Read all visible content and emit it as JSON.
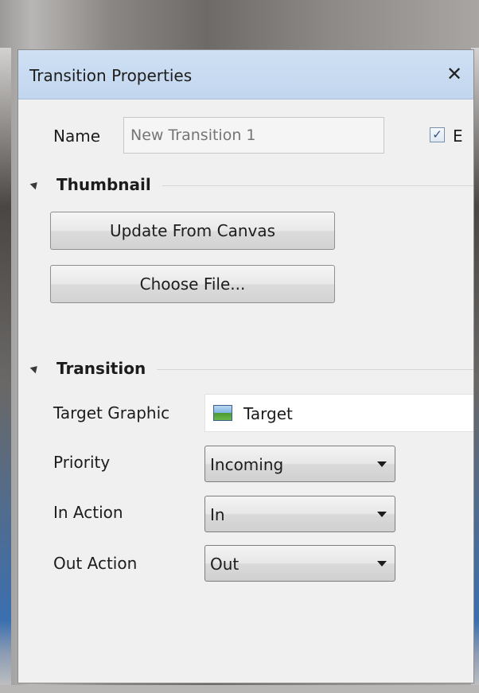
{
  "window": {
    "title": "Transition Properties",
    "close_glyph": "✕"
  },
  "name_row": {
    "label": "Name",
    "placeholder": "New Transition 1",
    "checkbox_checked": true,
    "checkbox_glyph": "✓",
    "checkbox_label": "E"
  },
  "thumbnail": {
    "header": "Thumbnail",
    "update_button": "Update From Canvas",
    "choose_button": "Choose File..."
  },
  "transition": {
    "header": "Transition",
    "target_label": "Target Graphic",
    "target_value": "Target",
    "target_icon": "image-icon",
    "priority_label": "Priority",
    "priority_value": "Incoming",
    "in_action_label": "In Action",
    "in_action_value": "In",
    "out_action_label": "Out Action",
    "out_action_value": "Out"
  },
  "colors": {
    "titlebar": "#c8dbf1",
    "panel_bg": "#f0f0f0"
  }
}
